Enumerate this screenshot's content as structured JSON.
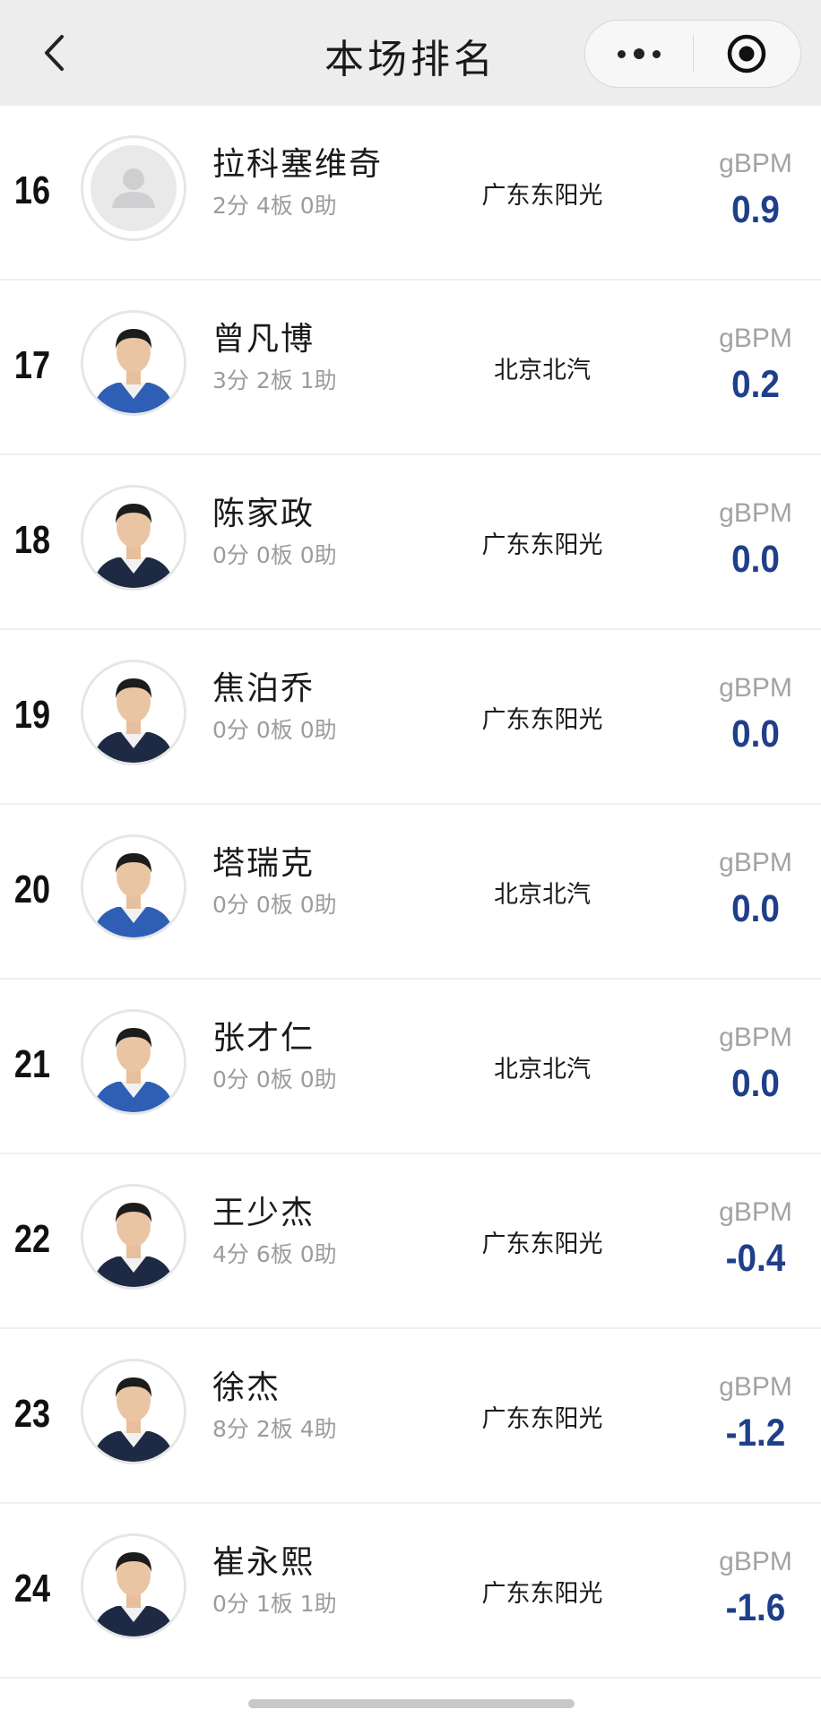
{
  "header": {
    "title": "本场排名"
  },
  "metric_label": "gBPM",
  "rows": [
    {
      "rank": "16",
      "name": "拉科塞维奇",
      "stats": "2分 4板 0助",
      "team": "广东东阳光",
      "metric": "gBPM",
      "value": "0.9",
      "avatar": "placeholder",
      "jersey": "#2f5fb5"
    },
    {
      "rank": "17",
      "name": "曾凡博",
      "stats": "3分 2板 1助",
      "team": "北京北汽",
      "metric": "gBPM",
      "value": "0.2",
      "avatar": "player",
      "jersey": "#2f5fb5"
    },
    {
      "rank": "18",
      "name": "陈家政",
      "stats": "0分 0板 0助",
      "team": "广东东阳光",
      "metric": "gBPM",
      "value": "0.0",
      "avatar": "player",
      "jersey": "#1e2a44"
    },
    {
      "rank": "19",
      "name": "焦泊乔",
      "stats": "0分 0板 0助",
      "team": "广东东阳光",
      "metric": "gBPM",
      "value": "0.0",
      "avatar": "player",
      "jersey": "#1e2a44"
    },
    {
      "rank": "20",
      "name": "塔瑞克",
      "stats": "0分 0板 0助",
      "team": "北京北汽",
      "metric": "gBPM",
      "value": "0.0",
      "avatar": "player",
      "jersey": "#2f5fb5"
    },
    {
      "rank": "21",
      "name": "张才仁",
      "stats": "0分 0板 0助",
      "team": "北京北汽",
      "metric": "gBPM",
      "value": "0.0",
      "avatar": "player",
      "jersey": "#2f5fb5"
    },
    {
      "rank": "22",
      "name": "王少杰",
      "stats": "4分 6板 0助",
      "team": "广东东阳光",
      "metric": "gBPM",
      "value": "-0.4",
      "avatar": "player",
      "jersey": "#1e2a44"
    },
    {
      "rank": "23",
      "name": "徐杰",
      "stats": "8分 2板 4助",
      "team": "广东东阳光",
      "metric": "gBPM",
      "value": "-1.2",
      "avatar": "player",
      "jersey": "#1e2a44"
    },
    {
      "rank": "24",
      "name": "崔永熙",
      "stats": "0分 1板 1助",
      "team": "广东东阳光",
      "metric": "gBPM",
      "value": "-1.6",
      "avatar": "player",
      "jersey": "#1e2a44"
    }
  ],
  "colors": {
    "value_blue": "#1f3f8a",
    "nav_bg": "#ededed",
    "muted_text": "#9c9c9c"
  },
  "icons": {
    "back": "chevron-left-icon",
    "more": "more-dots-icon",
    "close": "target-circle-icon"
  }
}
